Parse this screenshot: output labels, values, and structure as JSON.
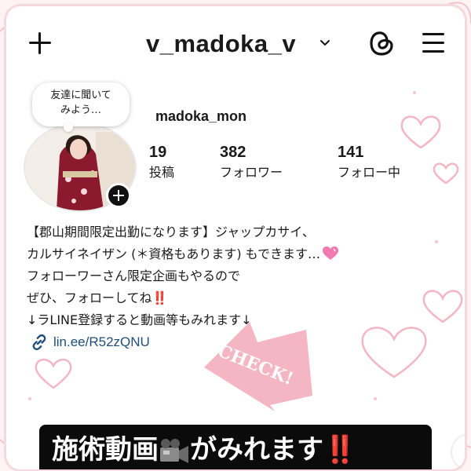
{
  "header": {
    "username": "v_madoka_v",
    "actions": [
      "new-post",
      "threads",
      "menu"
    ]
  },
  "profile": {
    "note_line1": "友達に聞いて",
    "note_line2": "みよう…",
    "display_name": "madoka_mon",
    "stats": [
      {
        "count": "19",
        "label": "投稿"
      },
      {
        "count": "382",
        "label": "フォロワー"
      },
      {
        "count": "141",
        "label": "フォロー中"
      }
    ]
  },
  "bio": {
    "line1": "【郡山期間限定出勤になります】ジャップカサイ、",
    "line2": "カルサイネイザン (＊資格もあります) もできます…",
    "line3": "フォローワーさん限定企画もやるので",
    "line4": "ぜひ、フォローしてね",
    "line4_mark": "‼️",
    "line5": "↓ラLINE登録すると動画等もみれます↓",
    "link": "lin.ee/R52zQNU"
  },
  "stamp": {
    "text": "CHECK!"
  },
  "caption": {
    "text_before": "施術動画",
    "text_after": "がみれます",
    "mark": "‼️"
  },
  "colors": {
    "accent_pink": "#f2a7b8",
    "link_blue": "#1f4e79",
    "caption_bg": "#0b0b0b",
    "alert_red": "#e0301e"
  }
}
